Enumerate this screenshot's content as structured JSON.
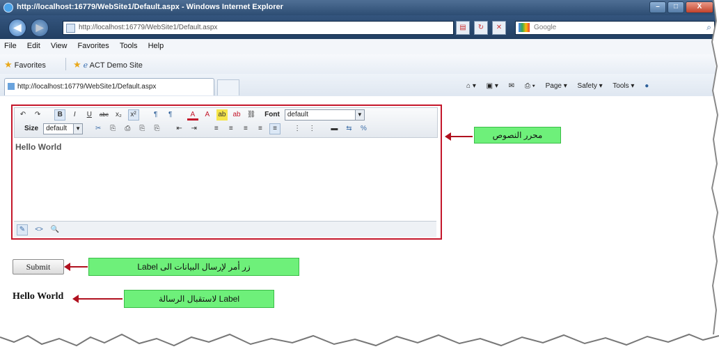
{
  "window": {
    "title": "http://localhost:16779/WebSite1/Default.aspx - Windows Internet Explorer",
    "controls": [
      "–",
      "□",
      "X"
    ]
  },
  "address_bar": {
    "url": "http://localhost:16779/WebSite1/Default.aspx",
    "search_placeholder": "Google"
  },
  "menu": [
    "File",
    "Edit",
    "View",
    "Favorites",
    "Tools",
    "Help"
  ],
  "favorites_bar": {
    "favorites_label": "Favorites",
    "link": "ACT Demo Site"
  },
  "tab": {
    "label": "http://localhost:16779/WebSite1/Default.aspx"
  },
  "command_bar": [
    "Page ▾",
    "Safety ▾",
    "Tools ▾"
  ],
  "editor": {
    "font_label": "Font",
    "font_value": "default",
    "size_label": "Size",
    "size_value": "default",
    "content": "Hello World",
    "toolbar_row1": [
      "↶",
      "↷",
      "B",
      "I",
      "U",
      "abc",
      "x₂",
      "x²",
      "¶",
      "¶",
      "A",
      "A",
      "ab",
      "ab",
      "⛓"
    ],
    "toolbar_row2": [
      "✂",
      "⎘",
      "⎙",
      "⎘",
      "⎘",
      "⇤",
      "⇥",
      "≡",
      "≡",
      "≡",
      "≡",
      "≡",
      "⋮",
      "⋮",
      "▬",
      "⇆",
      "%"
    ],
    "modes": [
      "✎",
      "<>",
      "🔍"
    ]
  },
  "submit_button": "Submit",
  "label_output": "Hello World",
  "callouts": {
    "editor": "محرر النصوص",
    "submit": "زر أمر لإرسال البيانات الى Label",
    "label": "Label لاستقبال الرسالة"
  },
  "colors": {
    "editor_border": "#c4162a",
    "callout_bg": "#6ef07a",
    "arrow": "#b0111f"
  }
}
